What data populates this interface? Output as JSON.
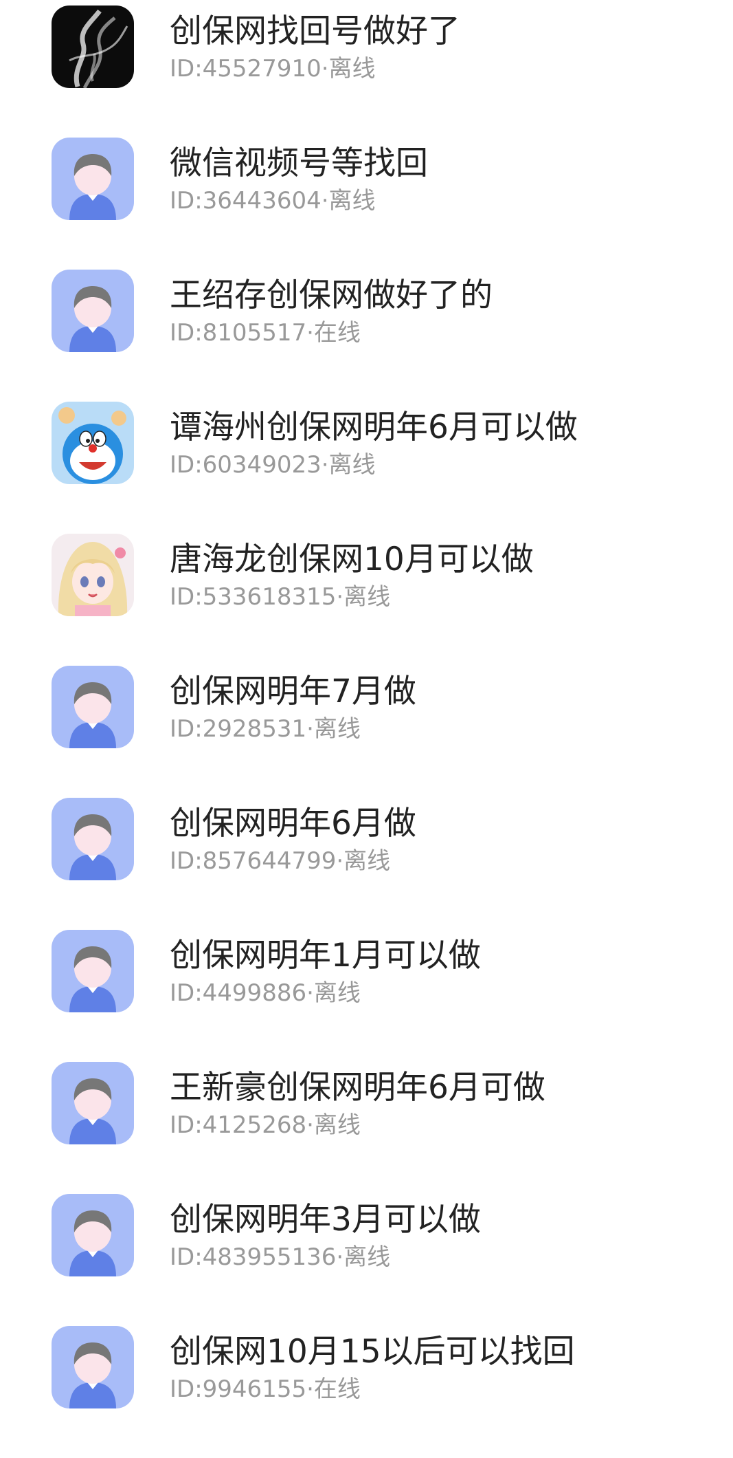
{
  "contacts": [
    {
      "name": "创保网找回号做好了",
      "status": "ID:45527910·离线",
      "avatar": "smoke-photo-avatar"
    },
    {
      "name": "微信视频号等找回",
      "status": "ID:36443604·离线",
      "avatar": "default-person-avatar"
    },
    {
      "name": "王绍存创保网做好了的",
      "status": "ID:8105517·在线",
      "avatar": "default-person-avatar"
    },
    {
      "name": "谭海州创保网明年6月可以做",
      "status": "ID:60349023·离线",
      "avatar": "cartoon-cat-avatar"
    },
    {
      "name": "唐海龙创保网10月可以做",
      "status": "ID:533618315·离线",
      "avatar": "anime-girl-avatar"
    },
    {
      "name": "创保网明年7月做",
      "status": "ID:2928531·离线",
      "avatar": "default-person-avatar"
    },
    {
      "name": "创保网明年6月做",
      "status": "ID:857644799·离线",
      "avatar": "default-person-avatar"
    },
    {
      "name": "创保网明年1月可以做",
      "status": "ID:4499886·离线",
      "avatar": "default-person-avatar"
    },
    {
      "name": "王新豪创保网明年6月可做",
      "status": "ID:4125268·离线",
      "avatar": "default-person-avatar"
    },
    {
      "name": "创保网明年3月可以做",
      "status": "ID:483955136·离线",
      "avatar": "default-person-avatar"
    },
    {
      "name": "创保网10月15以后可以找回",
      "status": "ID:9946155·在线",
      "avatar": "default-person-avatar"
    }
  ],
  "colors": {
    "default_avatar_bg": "#a8bcf8",
    "default_avatar_shirt": "#5f80e6",
    "default_avatar_hair": "#777777",
    "default_avatar_face": "#fbe4ea",
    "name_text": "#222222",
    "status_text": "#999999"
  }
}
